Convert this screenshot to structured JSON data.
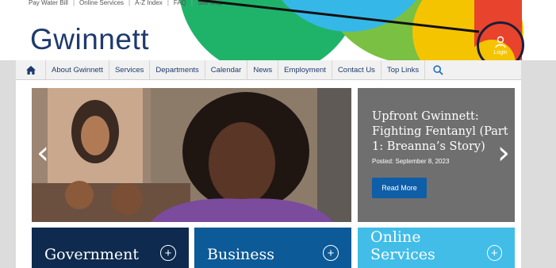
{
  "utility_links": [
    "Pay Water Bill",
    "Online Services",
    "A-Z Index",
    "FAQ",
    "Site Map"
  ],
  "logo": "Gwinnett",
  "login": {
    "label": "Login",
    "icon": "user-icon"
  },
  "nav": {
    "home_icon": "home-icon",
    "items": [
      "About Gwinnett",
      "Services",
      "Departments",
      "Calendar",
      "News",
      "Employment",
      "Contact Us",
      "Top Links"
    ],
    "search_icon": "search-icon"
  },
  "slide": {
    "title": "Upfront Gwinnett: Fighting Fentanyl (Part 1: Breanna’s Story)",
    "posted": "Posted: September 8, 2023",
    "button": "Read More",
    "prev": "‹",
    "next": "›"
  },
  "tiles": [
    {
      "label": "Government",
      "color": "#0e2a4e"
    },
    {
      "label": "Business",
      "color": "#0c5a97"
    },
    {
      "label": "Online Services",
      "color": "#41bde8"
    }
  ],
  "colors": {
    "brand_navy": "#1e3a6e",
    "login_red": "#e8432c",
    "button_blue": "#0f5ea8"
  }
}
